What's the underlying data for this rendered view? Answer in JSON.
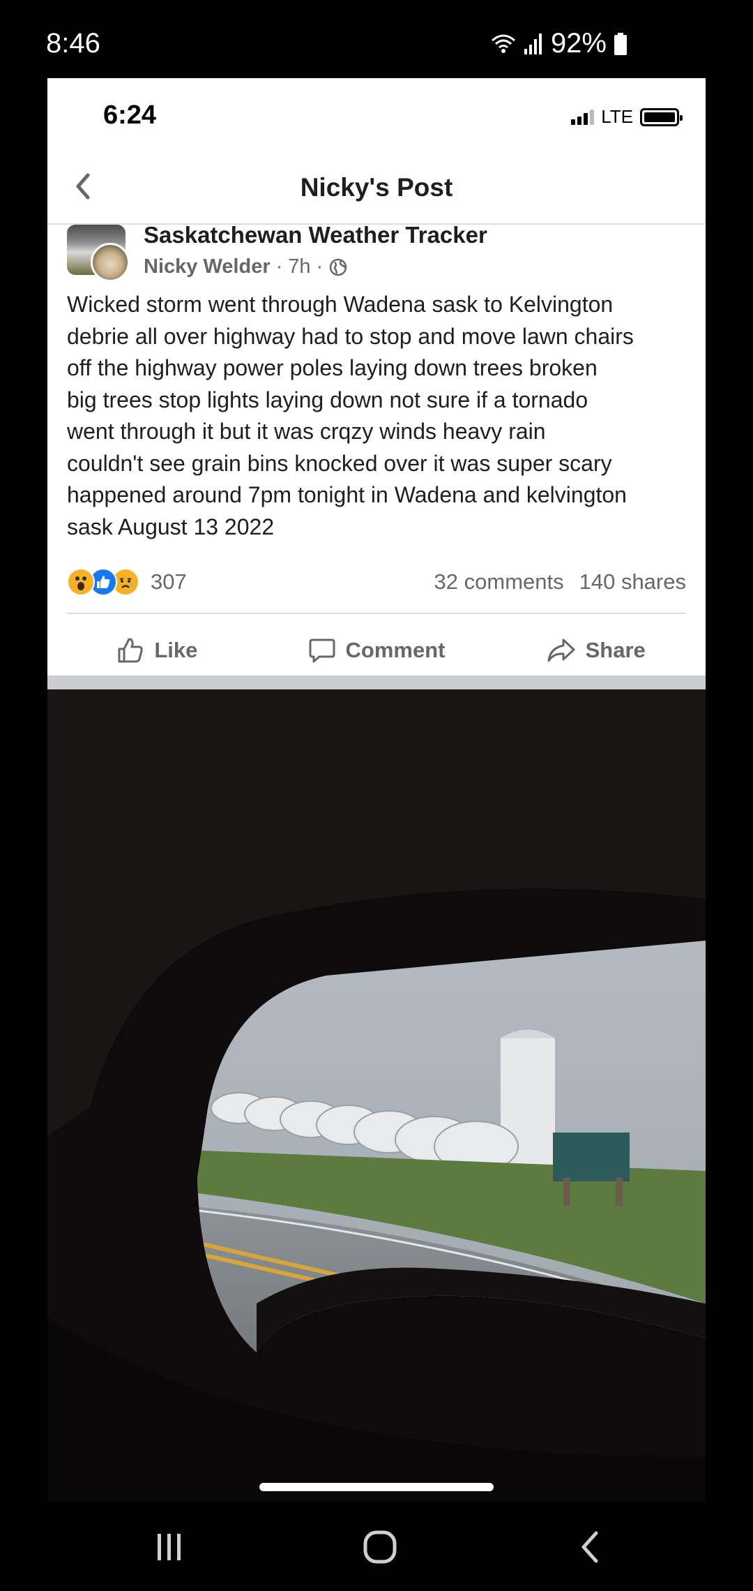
{
  "system_status": {
    "time": "8:46",
    "battery": "92%",
    "icons": [
      "wifi-icon",
      "signal-icon",
      "battery-icon"
    ]
  },
  "inner_status": {
    "time": "6:24",
    "network": "LTE"
  },
  "header": {
    "title": "Nicky's Post",
    "back_icon": "chevron-left-icon"
  },
  "post": {
    "group_name": "Saskatchewan Weather Tracker",
    "author": "Nicky Welder",
    "time": "7h",
    "separator": "·",
    "privacy_icon": "globe-icon",
    "text_lines": [
      "Wicked storm went through Wadena sask to Kelvington",
      "debrie all over highway had to stop and move lawn chairs",
      "off the highway power poles laying down trees broken",
      "big trees stop lights laying down not sure if a tornado",
      "went through it but it was crqzy winds heavy rain",
      "couldn't see grain bins knocked over it was super scary",
      "happened around 7pm tonight in Wadena and kelvington",
      "sask August 13 2022"
    ],
    "reaction_count": "307",
    "comments": "32 comments",
    "shares": "140 shares"
  },
  "actions": {
    "like": "Like",
    "comment": "Comment",
    "share": "Share"
  },
  "colors": {
    "facebook_blue": "#1877f2",
    "reaction_yellow": "#f7b125",
    "secondary_text": "#65676b",
    "divider": "#dadde1"
  }
}
